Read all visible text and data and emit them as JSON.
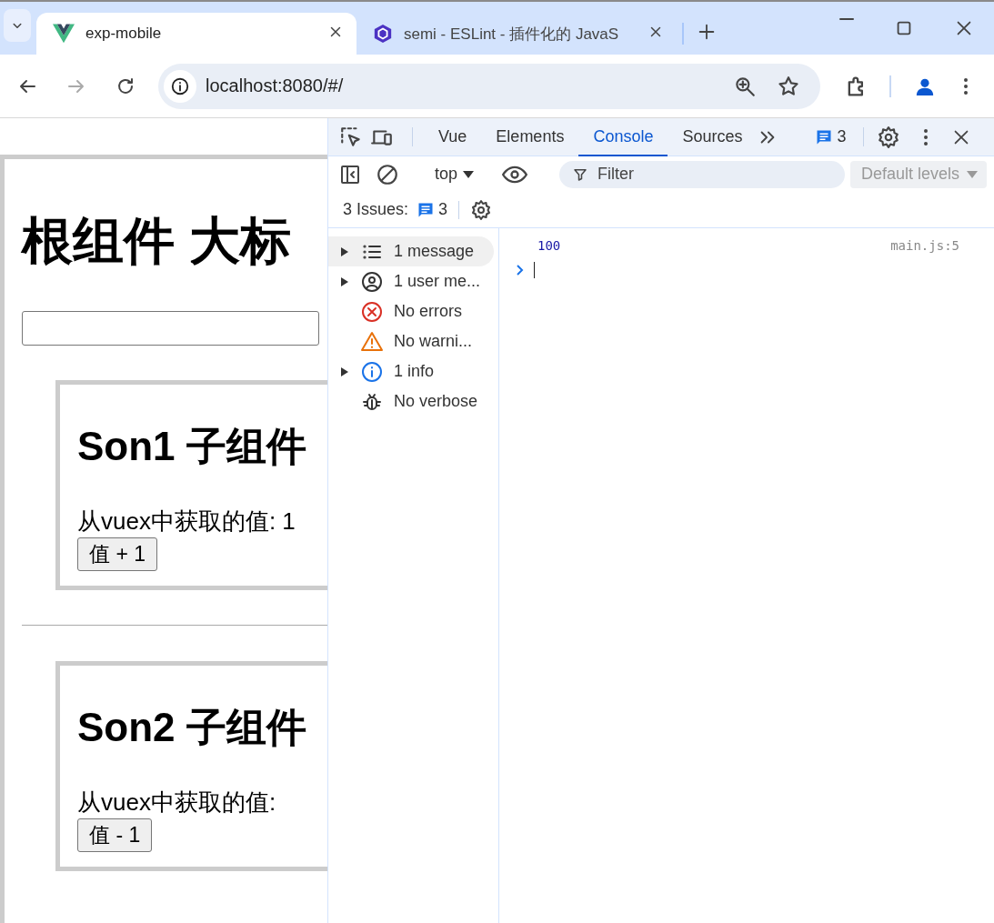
{
  "browser": {
    "tabs": [
      {
        "title": "exp-mobile",
        "kind": "vue",
        "selected": true
      },
      {
        "title": "semi - ESLint - 插件化的 JavaS",
        "kind": "hexagon",
        "selected": false
      }
    ],
    "address": "localhost:8080/#/"
  },
  "page": {
    "heading": "根组件 大标",
    "children": [
      {
        "heading": "Son1 子组件",
        "value_text": "从vuex中获取的值: 1",
        "button": "值 + 1"
      },
      {
        "heading": "Son2 子组件",
        "value_text": "从vuex中获取的值:",
        "button": "值 - 1"
      }
    ]
  },
  "devtools": {
    "tabs": [
      {
        "label": "Vue",
        "selected": false
      },
      {
        "label": "Elements",
        "selected": false
      },
      {
        "label": "Console",
        "selected": true
      },
      {
        "label": "Sources",
        "selected": false
      }
    ],
    "issues_badge": "3",
    "context": "top",
    "filter_placeholder": "Filter",
    "levels": "Default levels",
    "issues_label": "3 Issues:",
    "issues_count": "3",
    "sidebar": [
      {
        "label": "1 message",
        "kind": "list",
        "expandable": true,
        "selected": true
      },
      {
        "label": "1 user me...",
        "kind": "user",
        "expandable": true,
        "selected": false
      },
      {
        "label": "No errors",
        "kind": "error",
        "expandable": false,
        "selected": false
      },
      {
        "label": "No warni...",
        "kind": "warning",
        "expandable": false,
        "selected": false
      },
      {
        "label": "1 info",
        "kind": "info",
        "expandable": true,
        "selected": false
      },
      {
        "label": "No verbose",
        "kind": "verbose",
        "expandable": false,
        "selected": false
      }
    ],
    "messages": [
      {
        "text": "100",
        "source": "main.js:5"
      }
    ]
  }
}
